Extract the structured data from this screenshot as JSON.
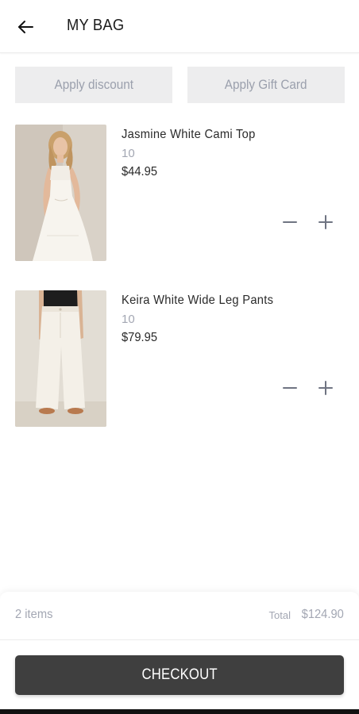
{
  "header": {
    "title": "MY BAG",
    "back_icon": "arrow-left-icon"
  },
  "actions": {
    "discount_label": "Apply discount",
    "gift_card_label": "Apply Gift Card"
  },
  "items": [
    {
      "name": "Jasmine White Cami Top",
      "size": "10",
      "price": "$44.95",
      "image": "model-white-cami-top-photo"
    },
    {
      "name": "Keira White Wide Leg Pants",
      "size": "10",
      "price": "$79.95",
      "image": "model-white-wide-leg-pants-photo"
    }
  ],
  "summary": {
    "item_count": "2 items",
    "total_label": "Total",
    "total_value": "$124.90"
  },
  "checkout": {
    "label": "CHECKOUT"
  },
  "colors": {
    "accent_dark": "#3f3f3f",
    "muted_text": "#a3a7b3",
    "button_bg": "#ededee"
  }
}
